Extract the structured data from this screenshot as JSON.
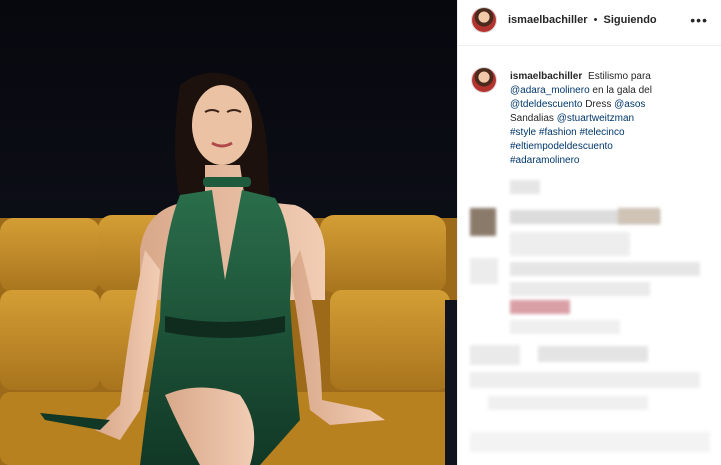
{
  "post": {
    "author": "ismaelbachiller",
    "separator": "•",
    "follow_status": "Siguiendo",
    "more_icon": "more-horizontal-icon",
    "caption": {
      "username": "ismaelbachiller",
      "line1": "Estilismo para",
      "mention_adara": "@adara_molinero",
      "text_gala": "en la gala del",
      "mention_tdd": "@tdeldescuento",
      "text_dress": "Dress",
      "mention_asos": "@asos",
      "text_sandalias": "Sandalias",
      "mention_stuart": "@stuartweitzman",
      "hashtags": [
        "#style",
        "#fashion",
        "#telecinco",
        "#eltiempodeldescuento",
        "#adaramolinero"
      ]
    }
  },
  "colors": {
    "link": "#00376b",
    "text": "#262626",
    "sofa": "#c8922c",
    "dress": "#1e5a3c",
    "background": "#0c0f18"
  }
}
